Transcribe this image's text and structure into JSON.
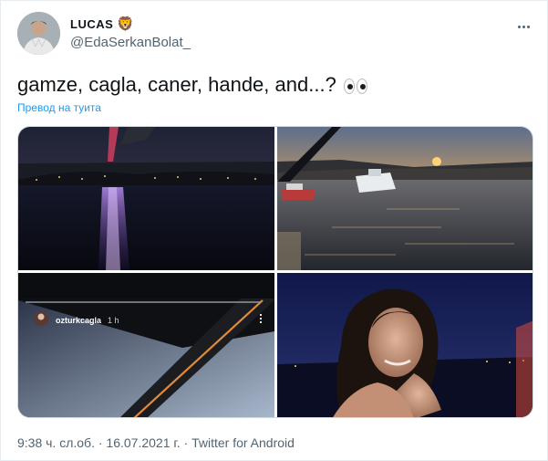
{
  "author": {
    "display_name": "LUCAS",
    "badge_emoji": "🦁",
    "handle": "@EdaSerkanBolat_"
  },
  "tweet": {
    "text": "gamze, cagla, caner, hande, and...?",
    "translate_label": "Превод на туита"
  },
  "media": {
    "story_overlay": {
      "username": "ozturkcagla",
      "time": "1 h"
    }
  },
  "meta": {
    "timestamp": "9:38 ч. сл.об. · 16.07.2021 г. · Twitter for Android"
  },
  "icons": {
    "more": "more-dots-icon",
    "emoji": "eyes-emoji"
  },
  "colors": {
    "link": "#1d9bf0",
    "secondary_text": "#536471",
    "border": "#cfd9de"
  }
}
